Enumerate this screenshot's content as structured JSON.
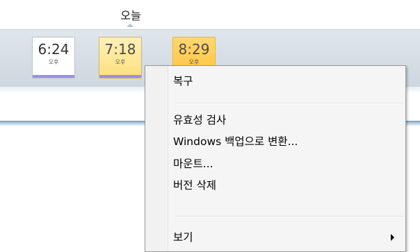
{
  "timeline": {
    "today_label": "오늘",
    "tiles": [
      {
        "time": "6:24",
        "ampm": "오후",
        "state": "normal"
      },
      {
        "time": "7:18",
        "ampm": "오후",
        "state": "selected"
      },
      {
        "time": "8:29",
        "ampm": "오후",
        "state": "active"
      }
    ]
  },
  "context_menu": {
    "items": [
      {
        "label": "복구"
      },
      {
        "label": "유효성 검사"
      },
      {
        "label": "Windows 백업으로 변환..."
      },
      {
        "label": "마운트..."
      },
      {
        "label": "버전 삭제"
      },
      {
        "label": "보기",
        "has_submenu": true
      }
    ]
  },
  "colors": {
    "timeline_bg": "#d6dfe6",
    "tile_selected": "#ffe07c",
    "tile_active": "#ffc33b",
    "tile_bar": "#9a8ee6",
    "menu_bg": "#f5f5f5",
    "blue_rule": "#6f95b4"
  }
}
